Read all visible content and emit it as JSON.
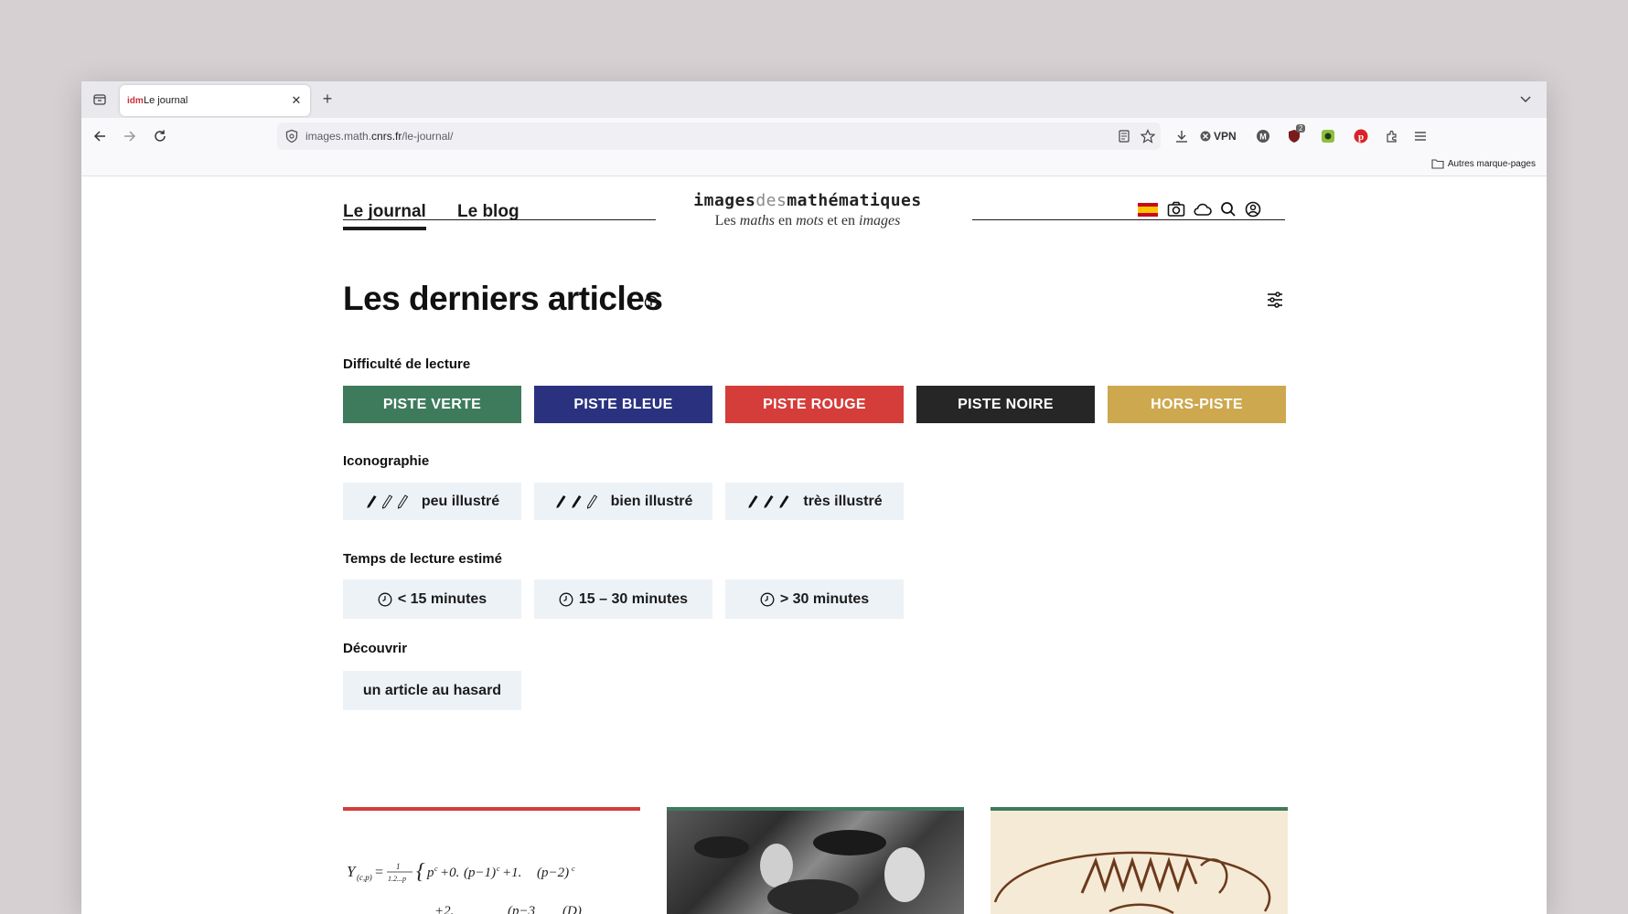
{
  "browser": {
    "tab_title": "Le journal",
    "tab_favicon": "idm",
    "url_prefix": "images.math.",
    "url_domain": "cnrs.fr",
    "url_path": "/le-journal/",
    "vpn_label": "VPN",
    "bookmarks_other": "Autres marque-pages",
    "badge_count": "2"
  },
  "site": {
    "nav_journal": "Le journal",
    "nav_blog": "Le blog",
    "logo_images": "images",
    "logo_des": "des",
    "logo_maths": "mathématiques",
    "tagline_1": "Les ",
    "tagline_2": "maths",
    "tagline_3": " en ",
    "tagline_4": "mots",
    "tagline_5": " et en ",
    "tagline_6": "images"
  },
  "main": {
    "title": "Les derniers articles",
    "difficulty_label": "Difficulté de lecture",
    "pistes": [
      {
        "label": "PISTE VERTE",
        "color": "#3e7b5c"
      },
      {
        "label": "PISTE BLEUE",
        "color": "#2a3280"
      },
      {
        "label": "PISTE ROUGE",
        "color": "#d43d3a"
      },
      {
        "label": "PISTE NOIRE",
        "color": "#262626"
      },
      {
        "label": "HORS-PISTE",
        "color": "#cda84e"
      }
    ],
    "icono_label": "Iconographie",
    "icono": [
      {
        "label": "peu illustré",
        "filled": 1
      },
      {
        "label": "bien illustré",
        "filled": 2
      },
      {
        "label": "très illustré",
        "filled": 3
      }
    ],
    "time_label": "Temps de lecture estimé",
    "times": [
      "< 15 minutes",
      "15 – 30 minutes",
      "> 30 minutes"
    ],
    "discover_label": "Découvrir",
    "random_article": "un article au hasard"
  },
  "cards": [
    {
      "bar_color": "#d43d3a"
    },
    {
      "bar_color": "#3e7b5c"
    },
    {
      "bar_color": "#3e7b5c"
    }
  ]
}
